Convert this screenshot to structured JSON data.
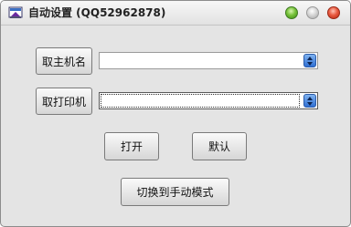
{
  "window": {
    "title": "自动设置 (QQ52962878)",
    "controls": [
      "minimize",
      "zoom",
      "close"
    ]
  },
  "form": {
    "host_button_label": "取主机名",
    "host_select_value": "",
    "printer_button_label": "取打印机",
    "printer_select_value": "",
    "open_button_label": "打开",
    "default_button_label": "默认",
    "switch_mode_button_label": "切换到手动模式"
  },
  "icons": {
    "app": "app-icon",
    "combo_arrow": "up-down-arrows-icon"
  },
  "colors": {
    "window_bg": "#e4e4e4",
    "minimize": "#5cb82f",
    "zoom": "#c8c8c8",
    "close": "#e0492f",
    "combo_arrow": "#3b7ddd"
  }
}
